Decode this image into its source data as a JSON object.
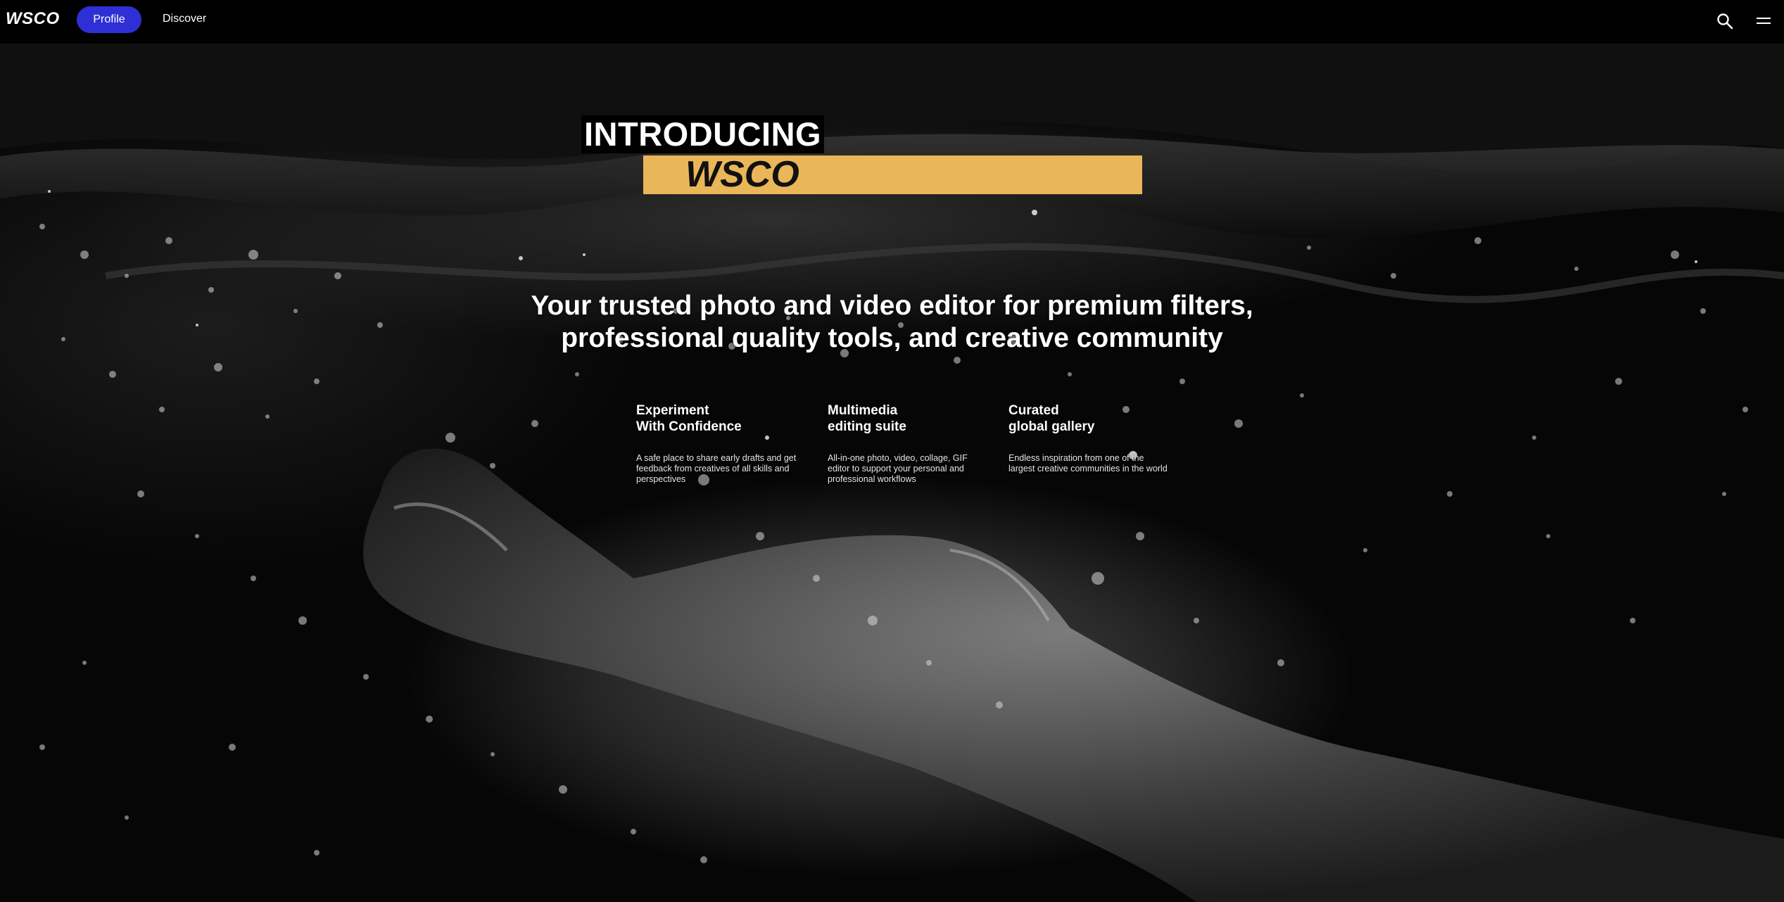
{
  "nav": {
    "logo": "WSCO",
    "profile_label": "Profile",
    "discover_label": "Discover",
    "profile_color": "#2f2fd6",
    "icons": [
      "search-icon",
      "menu-icon"
    ]
  },
  "hero": {
    "intro": "INTRODUCING",
    "brand": "WSCO",
    "accent_color": "#eab65a",
    "tagline_line1": "Your trusted photo and video editor for premium filters,",
    "tagline_line2": "professional quality tools, and creative community",
    "features": [
      {
        "title": "Experiment\nWith Confidence",
        "description": "A safe place to share early drafts and get feedback from creatives of all skills and perspectives"
      },
      {
        "title": "Multimedia\nediting suite",
        "description": "All-in-one photo, video, collage, GIF editor to support your personal and professional workflows"
      },
      {
        "title": "Curated\nglobal gallery",
        "description": "Endless inspiration from one of the largest creative communities in the world"
      }
    ]
  }
}
